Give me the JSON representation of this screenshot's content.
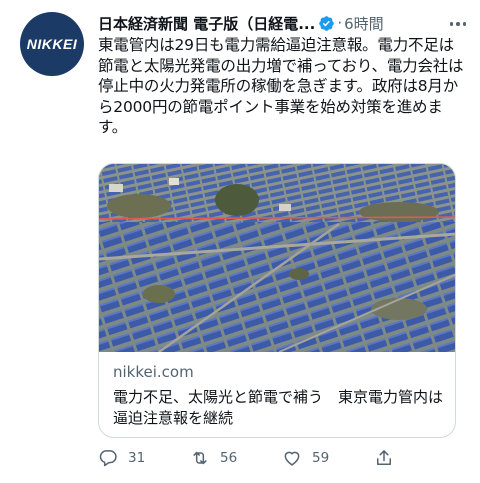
{
  "account": {
    "avatar_text": "NIKKEI",
    "display_name": "日本経済新聞 電子版（日経電...",
    "separator": "·",
    "time": "6時間"
  },
  "tweet": {
    "text": "東電管内は29日も電力需給逼迫注意報。電力不足は節電と太陽光発電の出力増で補っており、電力会社は停止中の火力発電所の稼働を急ぎます。政府は8月から2000円の節電ポイント事業を始め対策を進めます。"
  },
  "card": {
    "domain": "nikkei.com",
    "title": "電力不足、太陽光と節電で補う　東京電力管内は逼迫注意報を継続"
  },
  "actions": {
    "reply_count": "31",
    "retweet_count": "56",
    "like_count": "59"
  },
  "colors": {
    "avatar_bg": "#1c3a66",
    "verified": "#1d9bf0",
    "secondary_text": "#536471",
    "border": "#cfd9de"
  }
}
